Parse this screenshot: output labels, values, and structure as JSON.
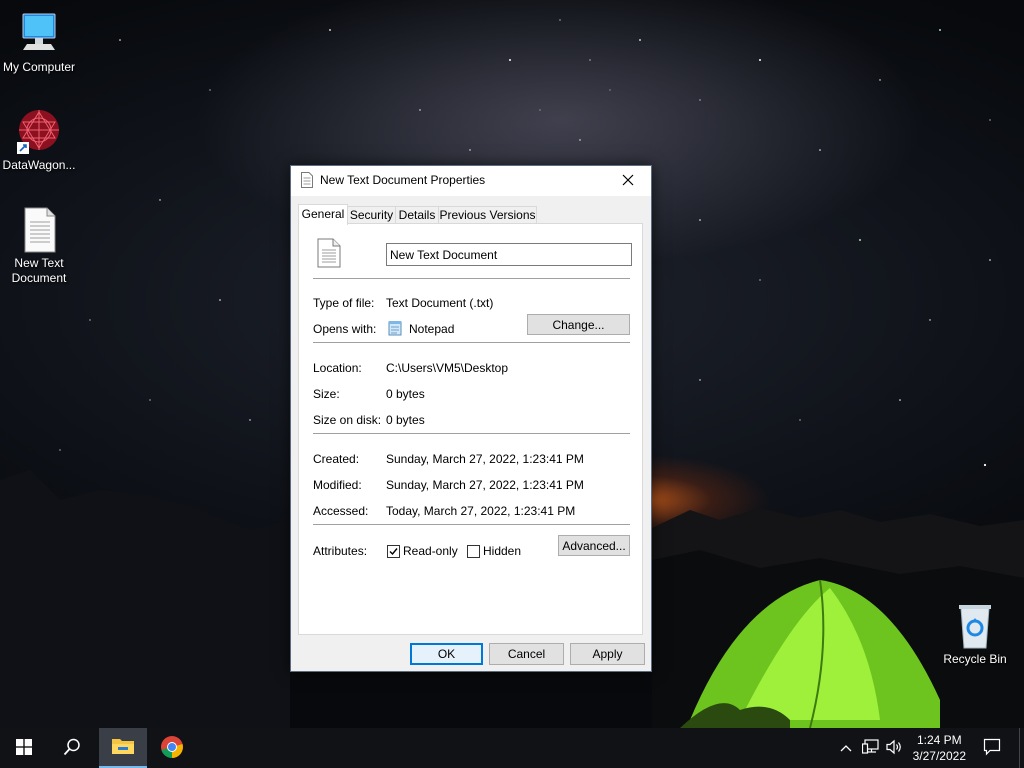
{
  "desktop": {
    "icons": [
      {
        "label": "My Computer",
        "icon": "computer-icon"
      },
      {
        "label": "DataWagon...",
        "icon": "datawagon-shortcut-icon"
      },
      {
        "label": "New Text Document",
        "label_line1": "New Text",
        "label_line2": "Document",
        "icon": "text-file-icon"
      },
      {
        "label": "Recycle Bin",
        "icon": "recycle-bin-icon"
      }
    ]
  },
  "dialog": {
    "title": "New Text Document Properties",
    "tabs": [
      "General",
      "Security",
      "Details",
      "Previous Versions"
    ],
    "active_tab": "General",
    "file_name_value": "New Text Document",
    "rows": {
      "type_label": "Type of file:",
      "type_value": "Text Document (.txt)",
      "opens_label": "Opens with:",
      "opens_value": "Notepad",
      "change_button": "Change...",
      "location_label": "Location:",
      "location_value": "C:\\Users\\VM5\\Desktop",
      "size_label": "Size:",
      "size_value": "0 bytes",
      "size_on_disk_label": "Size on disk:",
      "size_on_disk_value": "0 bytes",
      "created_label": "Created:",
      "created_value": "Sunday, March 27, 2022, 1:23:41 PM",
      "modified_label": "Modified:",
      "modified_value": "Sunday, March 27, 2022, 1:23:41 PM",
      "accessed_label": "Accessed:",
      "accessed_value": "Today, March 27, 2022, 1:23:41 PM",
      "attributes_label": "Attributes:",
      "readonly_label": "Read-only",
      "readonly_checked": true,
      "hidden_label": "Hidden",
      "hidden_checked": false,
      "advanced_button": "Advanced..."
    },
    "buttons": {
      "ok": "OK",
      "cancel": "Cancel",
      "apply": "Apply"
    }
  },
  "taskbar": {
    "time": "1:24 PM",
    "date": "3/27/2022",
    "accent": "#76b9ed"
  },
  "colors": {
    "focus_blue": "#0078d7",
    "tent_green": "#7fe12a"
  }
}
